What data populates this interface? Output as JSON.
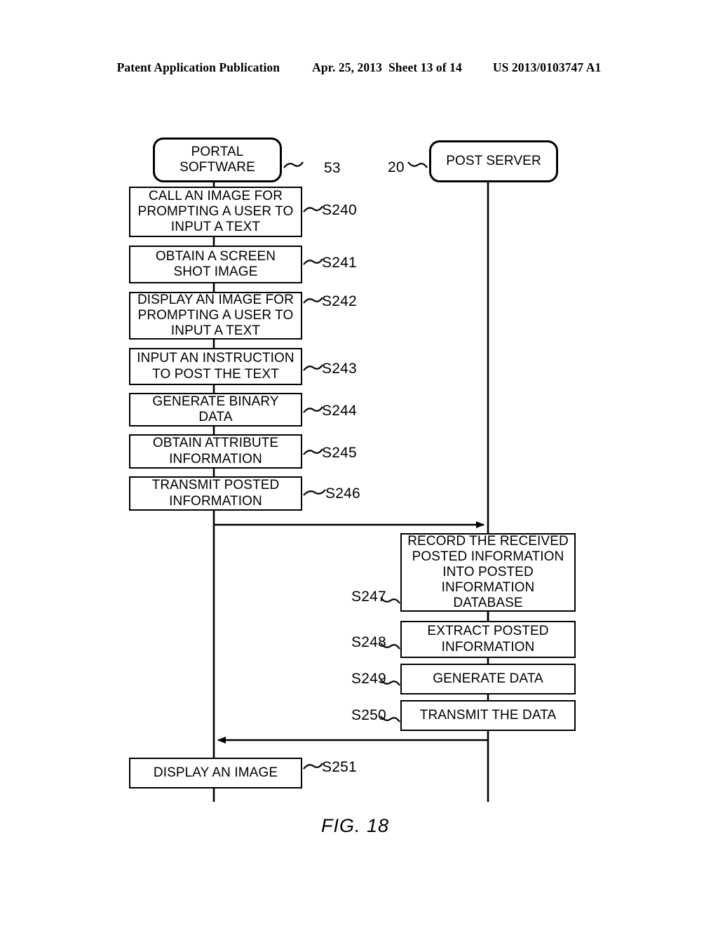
{
  "header": {
    "publication": "Patent Application Publication",
    "date": "Apr. 25, 2013",
    "sheet": "Sheet 13 of 14",
    "number": "US 2013/0103747 A1"
  },
  "figure": {
    "caption": "FIG. 18",
    "actors": [
      {
        "id": "portal",
        "label_lines": [
          "PORTAL",
          "SOFTWARE"
        ],
        "ref": "53"
      },
      {
        "id": "server",
        "label_lines": [
          "POST SERVER"
        ],
        "ref": "20"
      }
    ],
    "left_steps": [
      {
        "ref": "S240",
        "lines": [
          "CALL AN IMAGE FOR",
          "PROMPTING A USER TO",
          "INPUT A TEXT"
        ]
      },
      {
        "ref": "S241",
        "lines": [
          "OBTAIN A SCREEN",
          "SHOT IMAGE"
        ]
      },
      {
        "ref": "S242",
        "lines": [
          "DISPLAY AN IMAGE FOR",
          "PROMPTING A USER TO",
          "INPUT A TEXT"
        ]
      },
      {
        "ref": "S243",
        "lines": [
          "INPUT AN INSTRUCTION",
          "TO POST THE TEXT"
        ]
      },
      {
        "ref": "S244",
        "lines": [
          "GENERATE BINARY",
          "DATA"
        ]
      },
      {
        "ref": "S245",
        "lines": [
          "OBTAIN ATTRIBUTE",
          "INFORMATION"
        ]
      },
      {
        "ref": "S246",
        "lines": [
          "TRANSMIT POSTED",
          "INFORMATION"
        ]
      }
    ],
    "right_steps": [
      {
        "ref": "S247",
        "lines": [
          "RECORD THE RECEIVED",
          "POSTED INFORMATION",
          "INTO POSTED",
          "INFORMATION",
          "DATABASE"
        ]
      },
      {
        "ref": "S248",
        "lines": [
          "EXTRACT POSTED",
          "INFORMATION"
        ]
      },
      {
        "ref": "S249",
        "lines": [
          "GENERATE DATA"
        ]
      },
      {
        "ref": "S250",
        "lines": [
          "TRANSMIT THE DATA"
        ]
      }
    ],
    "final_step": {
      "ref": "S251",
      "lines": [
        "DISPLAY AN IMAGE"
      ]
    }
  }
}
